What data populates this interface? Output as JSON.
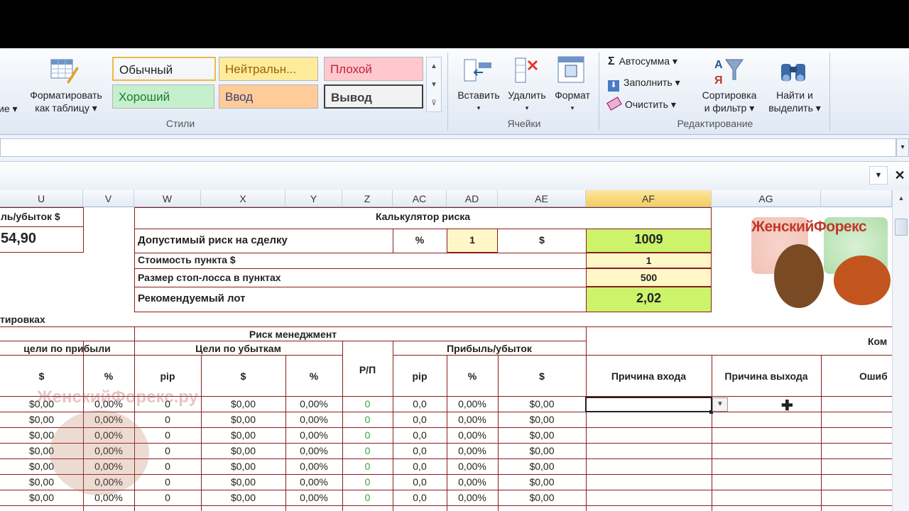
{
  "ribbon": {
    "partial_left_label": "ие",
    "format_table": {
      "line1": "Форматировать",
      "line2": "как таблицу"
    },
    "styles": [
      {
        "label": "Обычный",
        "bg": "#ffffff",
        "fg": "#222222"
      },
      {
        "label": "Нейтральн...",
        "bg": "#ffeb9c",
        "fg": "#9c6500"
      },
      {
        "label": "Плохой",
        "bg": "#ffc7ce",
        "fg": "#c0233a"
      },
      {
        "label": "Хороший",
        "bg": "#c6efce",
        "fg": "#1e7a2e"
      },
      {
        "label": "Ввод",
        "bg": "#ffcc99",
        "fg": "#3f3f76"
      },
      {
        "label": "Вывод",
        "bg": "#f2f2f2",
        "fg": "#3f3f3f"
      }
    ],
    "group_styles": "Стили",
    "cells": {
      "insert": "Вставить",
      "delete": "Удалить",
      "format": "Формат",
      "group": "Ячейки"
    },
    "editing": {
      "autosum": "Автосумма",
      "fill": "Заполнить",
      "clear": "Очистить",
      "sort_line1": "Сортировка",
      "sort_line2": "и фильтр",
      "find_line1": "Найти и",
      "find_line2": "выделить",
      "group": "Редактирование"
    }
  },
  "columns": [
    "U",
    "V",
    "W",
    "X",
    "Y",
    "Z",
    "AC",
    "AD",
    "AE",
    "AF",
    "AG"
  ],
  "sheet": {
    "pnl_header": "ль/убыток $",
    "pnl_value": "54,90",
    "calc_title": "Калькулятор риска",
    "risk_label": "Допустимый риск на сделку",
    "risk_pct_sign": "%",
    "risk_pct": "1",
    "risk_usd_sign": "$",
    "risk_usd": "1009",
    "point_cost_label": "Стоимость пункта $",
    "point_cost": "1",
    "stop_label": "Размер стоп-лосса в пунктах",
    "stop": "500",
    "lot_label": "Рекомендуемый лот",
    "lot": "2,02",
    "section_partial": "тировках",
    "rm_title": "Риск менеджмент",
    "profit_targets": "цели по прибыли",
    "loss_targets": "Цели по убыткам",
    "rp": "Р/П",
    "pnl_group": "Прибыль/убыток",
    "komm_partial": "Ком",
    "sub_usd": "$",
    "sub_pct": "%",
    "sub_pip": "pip",
    "entry_reason": "Причина входа",
    "exit_reason": "Причина выхода",
    "errors_partial": "Ошиб",
    "logo_text": "ЖенскийФорекс",
    "watermark": "ЖенскийФорекс.ру",
    "row": {
      "u": "$0,00",
      "v": "0,00%",
      "w": "0",
      "x": "$0,00",
      "y": "0,00%",
      "z": "0",
      "ac": "0,0",
      "ad": "0,00%",
      "ae": "$0,00"
    }
  },
  "colors": {
    "accent_green": "#ccf36a",
    "light_yellow": "#fff7c8",
    "dark_red": "#8b1c1c",
    "rp_green": "#3aa33a"
  }
}
